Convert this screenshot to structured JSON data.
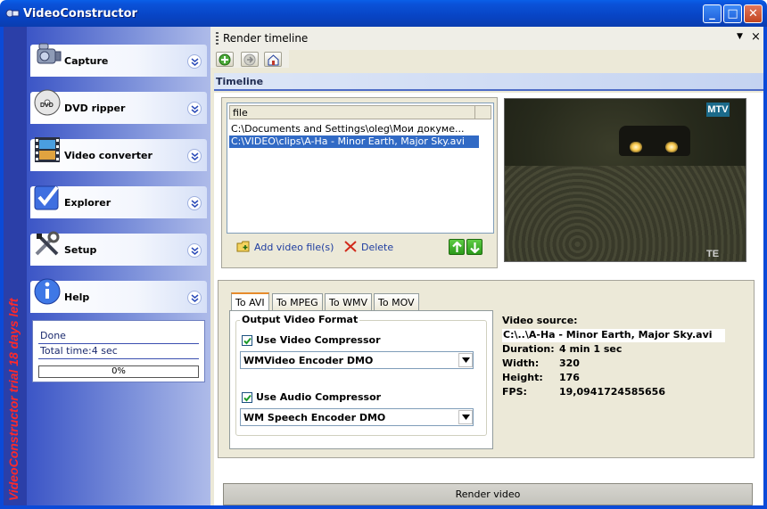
{
  "window": {
    "title": "VideoConstructor",
    "minimize": "_",
    "maximize": "□",
    "close": "✕"
  },
  "trial": {
    "text": "VideoConstructor trial 18 days left"
  },
  "nav": {
    "items": [
      {
        "label": "Capture",
        "icon": "camera-icon"
      },
      {
        "label": "DVD ripper",
        "icon": "dvd-icon"
      },
      {
        "label": "Video converter",
        "icon": "film-icon"
      },
      {
        "label": "Explorer",
        "icon": "checkmark-icon"
      },
      {
        "label": "Setup",
        "icon": "tools-icon"
      },
      {
        "label": "Help",
        "icon": "info-icon"
      }
    ]
  },
  "status": {
    "done": "Done",
    "total_time": "Total time:4 sec",
    "progress_text": "0%",
    "progress_value": 0
  },
  "main": {
    "title": "Render timeline",
    "dropdown": "▼",
    "close": "×",
    "section": "Timeline"
  },
  "filelist": {
    "header": "file",
    "files": [
      "C:\\Documents and Settings\\oleg\\Мои докуме...",
      "C:\\VIDEO\\clips\\A-Ha - Minor Earth, Major Sky.avi"
    ],
    "add": "Add video file(s)",
    "delete": "Delete"
  },
  "preview": {
    "logo": "MTV",
    "corner_mark": "TE"
  },
  "tabs": [
    "To AVI",
    "To MPEG",
    "To WMV",
    "To MOV"
  ],
  "format": {
    "legend": "Output Video Format",
    "use_video": "Use Video Compressor",
    "video_codec": "WMVideo Encoder DMO",
    "use_audio": "Use Audio Compressor",
    "audio_codec": "WM Speech Encoder DMO"
  },
  "info": {
    "title": "Video source:",
    "path": "C:\\..\\A-Ha - Minor Earth, Major Sky.avi",
    "duration_label": "Duration:",
    "duration": "4 min 1 sec",
    "width_label": "Width:",
    "width": "320",
    "height_label": "Height:",
    "height": "176",
    "fps_label": "FPS:",
    "fps": "19,0941724585656"
  },
  "render": {
    "label": "Render video"
  }
}
